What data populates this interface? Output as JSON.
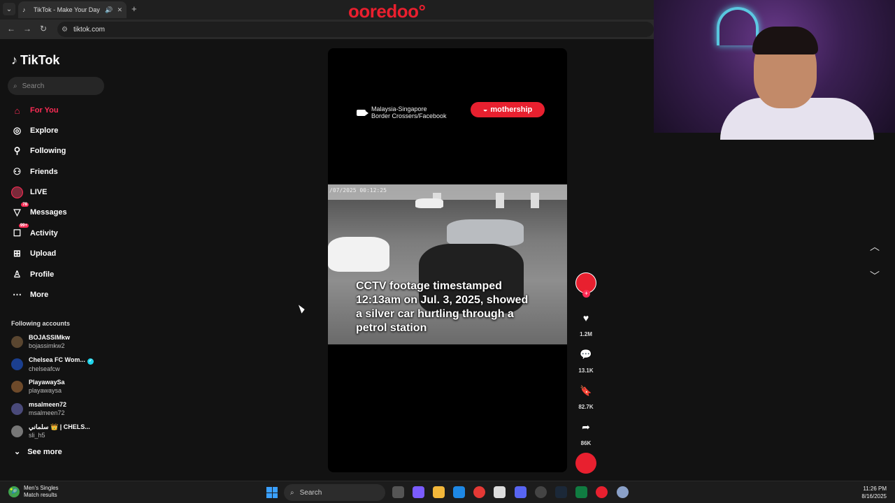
{
  "browser": {
    "tab_title": "TikTok - Make Your Day",
    "url": "tiktok.com",
    "brand_overlay": "ooredoo°"
  },
  "sidebar": {
    "logo_text": "TikTok",
    "search_placeholder": "Search",
    "nav": [
      {
        "label": "For You",
        "icon": "home-icon",
        "active": true
      },
      {
        "label": "Explore",
        "icon": "compass-icon"
      },
      {
        "label": "Following",
        "icon": "following-icon"
      },
      {
        "label": "Friends",
        "icon": "friends-icon"
      },
      {
        "label": "LIVE",
        "icon": "live-icon"
      },
      {
        "label": "Messages",
        "icon": "messages-icon",
        "badge": "78"
      },
      {
        "label": "Activity",
        "icon": "activity-icon",
        "badge": "99+"
      },
      {
        "label": "Upload",
        "icon": "upload-icon"
      },
      {
        "label": "Profile",
        "icon": "profile-icon"
      },
      {
        "label": "More",
        "icon": "more-icon"
      }
    ],
    "following_title": "Following accounts",
    "accounts": [
      {
        "name": "BOJASSIMkw",
        "handle": "bojassimkw2",
        "color": "#5a4630"
      },
      {
        "name": "Chelsea FC Wom...",
        "handle": "chelseafcw",
        "color": "#1b3f8f",
        "verified": true
      },
      {
        "name": "PlayawaySa",
        "handle": "playawaysa",
        "color": "#6e4a2a"
      },
      {
        "name": "msalmeen72",
        "handle": "msalmeen72",
        "color": "#4a4a7a"
      },
      {
        "name": "سلماني 👑 | CHELS...",
        "handle": "sli_h5",
        "color": "#777777"
      }
    ],
    "see_more": "See more"
  },
  "video": {
    "credit_line1": "Malaysia-Singapore",
    "credit_line2": "Border Crossers/Facebook",
    "brand_pill": "mothership",
    "timestamp": "/07/2025 00:12:25",
    "caption": "CCTV footage timestamped 12:13am on Jul. 3, 2025, showed a silver car hurtling through a petrol station"
  },
  "actions": {
    "likes": "1.2M",
    "comments": "13.1K",
    "saves": "82.7K",
    "shares": "86K"
  },
  "taskbar": {
    "widget_title": "Men's Singles",
    "widget_sub": "Match results",
    "search_label": "Search",
    "time": "11:26 PM",
    "date": "8/16/2025"
  }
}
